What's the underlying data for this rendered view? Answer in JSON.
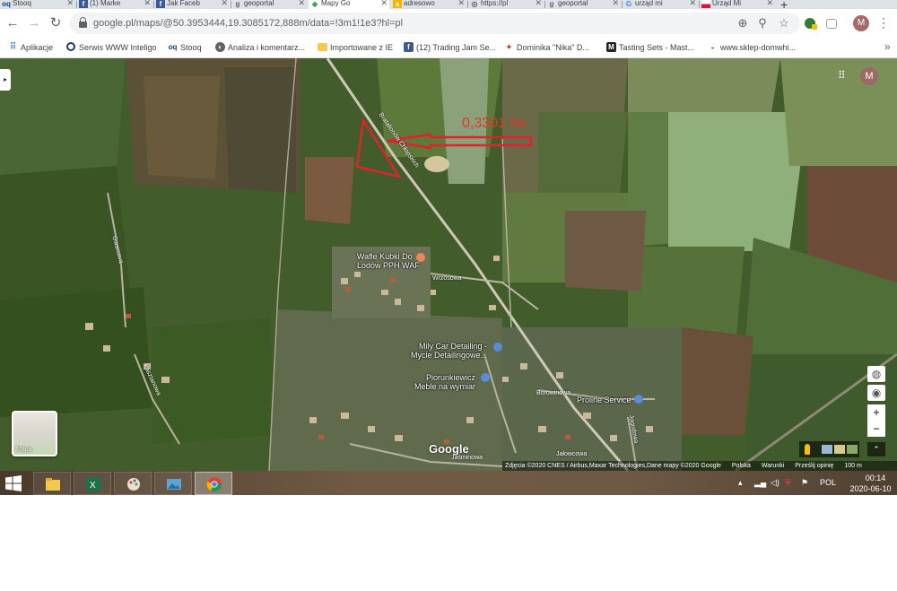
{
  "tabs": [
    {
      "title": "Stooq",
      "icon": "stooq-icon",
      "active": false
    },
    {
      "title": "(1) Marke",
      "icon": "facebook-icon",
      "active": false
    },
    {
      "title": "Jak Faceb",
      "icon": "facebook-icon",
      "active": false
    },
    {
      "title": "geoportal",
      "icon": "geoportal-icon",
      "active": false
    },
    {
      "title": "Mapy Go",
      "icon": "google-maps-icon",
      "active": true
    },
    {
      "title": "adresowo",
      "icon": "adresowo-icon",
      "active": false
    },
    {
      "title": "https://pl",
      "icon": "globe-icon",
      "active": false
    },
    {
      "title": "geoportal",
      "icon": "geoportal-icon",
      "active": false
    },
    {
      "title": "urząd mi",
      "icon": "google-g-icon",
      "active": false
    },
    {
      "title": "Urząd Mi",
      "icon": "poland-flag-icon",
      "active": false
    }
  ],
  "new_tab_label": "+",
  "address": {
    "url": "google.pl/maps/@50.3953444,19.3085172,888m/data=!3m1!1e3?hl=pl"
  },
  "profile_initial": "M",
  "bookmarks": [
    {
      "label": "Aplikacje",
      "icon": "apps-grid-icon"
    },
    {
      "label": "Serwis WWW Inteligo",
      "icon": "inteligo-icon"
    },
    {
      "label": "Stooq",
      "icon": "stooq-icon"
    },
    {
      "label": "Analiza i komentarz...",
      "icon": "globe-icon"
    },
    {
      "label": "Importowane z IE",
      "icon": "folder-icon"
    },
    {
      "label": "(12) Trading Jam Se...",
      "icon": "facebook-icon"
    },
    {
      "label": "Dominika \"Nika\" D...",
      "icon": "red-logo-icon"
    },
    {
      "label": "Tasting Sets - Mast...",
      "icon": "m-logo-icon"
    },
    {
      "label": "www.sklep-domwhi...",
      "icon": "bowl-icon"
    }
  ],
  "map": {
    "area_annotation": "0,3301 ha",
    "places": [
      {
        "name": "Wafle Kubki Do\nLodów PPH WAF",
        "line1": "Wafle Kubki Do",
        "line2": "Lodów PPH WAF"
      },
      {
        "name": "Mily Car Detailing - Mycie Detailingowe...",
        "line1": "Mily Car Detailing -",
        "line2": "Mycie Detailingowe..."
      },
      {
        "name": "Piorunkiewicz Meble na wymiar",
        "line1": "Piorunkiewicz",
        "line2": "Meble na wymiar"
      },
      {
        "name": "Proline Service",
        "line1": "Proline Service",
        "line2": ""
      }
    ],
    "roads": [
      "Bratalionów Chłopskich",
      "Wrzosowa",
      "Borowinowa",
      "Jagodowa",
      "Jałowcowa",
      "Jaśminowa",
      "Gwarcova",
      "Kasztanowa"
    ],
    "google_logo": "Google",
    "attribution": "Zdjęcia ©2020 CNES / Airbus,Maxar Technologies,Dane mapy ©2020 Google",
    "links": [
      "Polska",
      "Warunki",
      "Prześlij opinię"
    ],
    "scale_label": "100 m",
    "layer_toggle_label": "Mapa",
    "account_initial": "M",
    "zoom_in_label": "+",
    "zoom_out_label": "−"
  },
  "taskbar": {
    "apps": [
      {
        "name": "file-explorer-icon",
        "active": false
      },
      {
        "name": "excel-icon",
        "active": false
      },
      {
        "name": "paint-icon",
        "active": false
      },
      {
        "name": "photos-icon",
        "active": false
      },
      {
        "name": "chrome-icon",
        "active": true
      }
    ],
    "language": "POL",
    "time": "00:14",
    "date": "2020-06-10"
  }
}
